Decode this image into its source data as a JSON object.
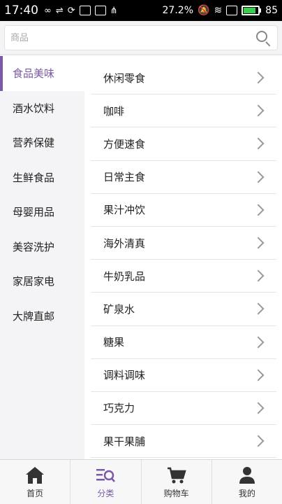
{
  "status_bar": {
    "time": "17:40",
    "battery_percent_text": "27.2",
    "battery_level": "85",
    "battery_color": "#38d04a"
  },
  "search": {
    "placeholder": "商品",
    "icon": "search-icon"
  },
  "sidebar": {
    "items": [
      {
        "label": "食品美味",
        "active": true
      },
      {
        "label": "酒水饮料"
      },
      {
        "label": "营养保健"
      },
      {
        "label": "生鲜食品"
      },
      {
        "label": "母婴用品"
      },
      {
        "label": "美容洗护"
      },
      {
        "label": "家居家电"
      },
      {
        "label": "大牌直邮"
      }
    ]
  },
  "subcategories": [
    "休闲零食",
    "咖啡",
    "方便速食",
    "日常主食",
    "果汁冲饮",
    "海外清真",
    "牛奶乳品",
    "矿泉水",
    "糖果",
    "调料调味",
    "巧克力",
    "果干果脯"
  ],
  "bottom_nav": {
    "items": [
      {
        "label": "首页",
        "icon": "home-icon"
      },
      {
        "label": "分类",
        "icon": "category-icon",
        "active": true
      },
      {
        "label": "购物车",
        "icon": "cart-icon"
      },
      {
        "label": "我的",
        "icon": "user-icon"
      }
    ]
  },
  "colors": {
    "accent": "#7a5aa6"
  }
}
